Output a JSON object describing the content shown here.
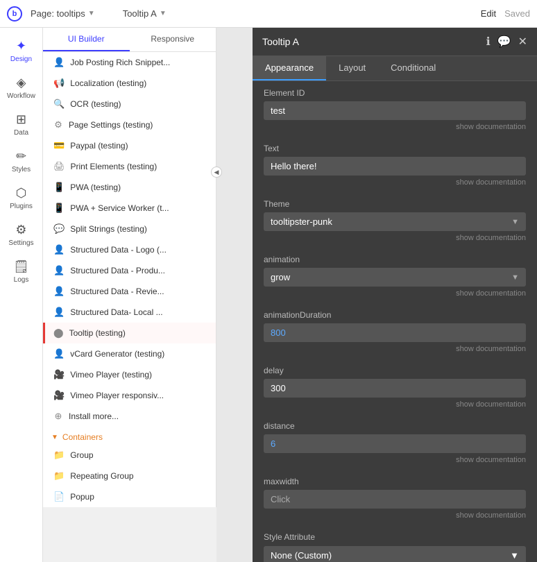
{
  "topbar": {
    "logo": "b",
    "page_label": "Page: tooltips",
    "chevron": "▼",
    "tooltip_label": "Tooltip A",
    "edit": "Edit",
    "saved": "Saved"
  },
  "icon_sidebar": {
    "items": [
      {
        "id": "design",
        "label": "Design",
        "icon": "✦",
        "active": true
      },
      {
        "id": "workflow",
        "label": "Workflow",
        "icon": "◈"
      },
      {
        "id": "data",
        "label": "Data",
        "icon": "⊞"
      },
      {
        "id": "styles",
        "label": "Styles",
        "icon": "✏"
      },
      {
        "id": "plugins",
        "label": "Plugins",
        "icon": "⬡"
      },
      {
        "id": "settings",
        "label": "Settings",
        "icon": "⚙"
      },
      {
        "id": "logs",
        "label": "Logs",
        "icon": "📄"
      }
    ]
  },
  "plugin_list": {
    "tabs": [
      "UI Builder",
      "Responsive"
    ],
    "active_tab": "UI Builder",
    "items": [
      {
        "icon": "👤",
        "label": "Job Posting Rich Snippet...",
        "selected": false
      },
      {
        "icon": "📢",
        "label": "Localization (testing)",
        "selected": false
      },
      {
        "icon": "🔍",
        "label": "OCR (testing)",
        "selected": false
      },
      {
        "icon": "⚙",
        "label": "Page Settings (testing)",
        "selected": false
      },
      {
        "icon": "💳",
        "label": "Paypal (testing)",
        "selected": false
      },
      {
        "icon": "🖨",
        "label": "Print Elements (testing)",
        "selected": false
      },
      {
        "icon": "📱",
        "label": "PWA (testing)",
        "selected": false
      },
      {
        "icon": "📱",
        "label": "PWA + Service Worker (t...",
        "selected": false
      },
      {
        "icon": "💬",
        "label": "Split Strings (testing)",
        "selected": false
      },
      {
        "icon": "👤",
        "label": "Structured Data - Logo (...",
        "selected": false
      },
      {
        "icon": "👤",
        "label": "Structured Data - Produ...",
        "selected": false
      },
      {
        "icon": "👤",
        "label": "Structured Data - Revie...",
        "selected": false
      },
      {
        "icon": "👤",
        "label": "Structured Data- Local ...",
        "selected": false
      },
      {
        "icon": "⬤",
        "label": "Tooltip (testing)",
        "selected": true
      },
      {
        "icon": "👤",
        "label": "vCard Generator (testing)",
        "selected": false
      },
      {
        "icon": "🎥",
        "label": "Vimeo Player (testing)",
        "selected": false
      },
      {
        "icon": "🎥",
        "label": "Vimeo Player responsiv...",
        "selected": false
      },
      {
        "icon": "⊕",
        "label": "Install more...",
        "selected": false
      }
    ],
    "containers_label": "Containers",
    "containers": [
      {
        "icon": "📁",
        "label": "Group"
      },
      {
        "icon": "📁",
        "label": "Repeating Group"
      },
      {
        "icon": "📄",
        "label": "Popup"
      }
    ]
  },
  "tooltip_panel": {
    "title": "Tooltip A",
    "tabs": [
      "Appearance",
      "Layout",
      "Conditional"
    ],
    "active_tab": "Appearance",
    "fields": {
      "element_id": {
        "label": "Element ID",
        "value": "test",
        "show_doc": "show documentation"
      },
      "text": {
        "label": "Text",
        "value": "Hello there!",
        "show_doc": "show documentation"
      },
      "theme": {
        "label": "Theme",
        "value": "tooltipster-punk",
        "show_doc": "show documentation"
      },
      "animation": {
        "label": "animation",
        "value": "grow",
        "show_doc": "show documentation"
      },
      "animation_duration": {
        "label": "animationDuration",
        "value": "800",
        "show_doc": "show documentation",
        "blue": true
      },
      "delay": {
        "label": "delay",
        "value": "300",
        "show_doc": "show documentation"
      },
      "distance": {
        "label": "distance",
        "value": "6",
        "show_doc": "show documentation",
        "blue": true
      },
      "maxwidth": {
        "label": "maxwidth",
        "value": "Click",
        "show_doc": "show documentation"
      }
    },
    "style_attribute": {
      "label": "Style Attribute",
      "value": "None (Custom)"
    }
  }
}
